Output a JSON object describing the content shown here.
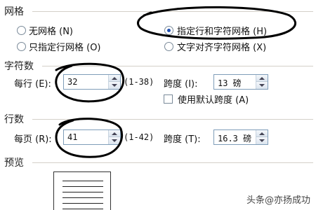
{
  "grid": {
    "section_title": "网格",
    "options": [
      {
        "label": "无网格 (N)",
        "selected": false
      },
      {
        "label": "指定行和字符网格 (H)",
        "selected": true
      },
      {
        "label": "只指定行网格 (O)",
        "selected": false
      },
      {
        "label": "文字对齐字符网格 (X)",
        "selected": false
      }
    ]
  },
  "chars": {
    "section_title": "字符数",
    "per_line_label": "每行 (E):",
    "per_line_value": "32",
    "range": "(1-38)",
    "pitch_label": "跨度 (I):",
    "pitch_value": "13 磅",
    "default_pitch_label": "使用默认跨度 (A)",
    "default_pitch_checked": false
  },
  "lines": {
    "section_title": "行数",
    "per_page_label": "每页 (R):",
    "per_page_value": "41",
    "range": "(1-42)",
    "pitch_label": "跨度 (T):",
    "pitch_value": "16.3 磅"
  },
  "preview": {
    "section_title": "预览"
  },
  "watermark": "头条@亦扬成功",
  "colors": {
    "annotation": "#000000",
    "radio_dot": "#1f4fb0"
  }
}
